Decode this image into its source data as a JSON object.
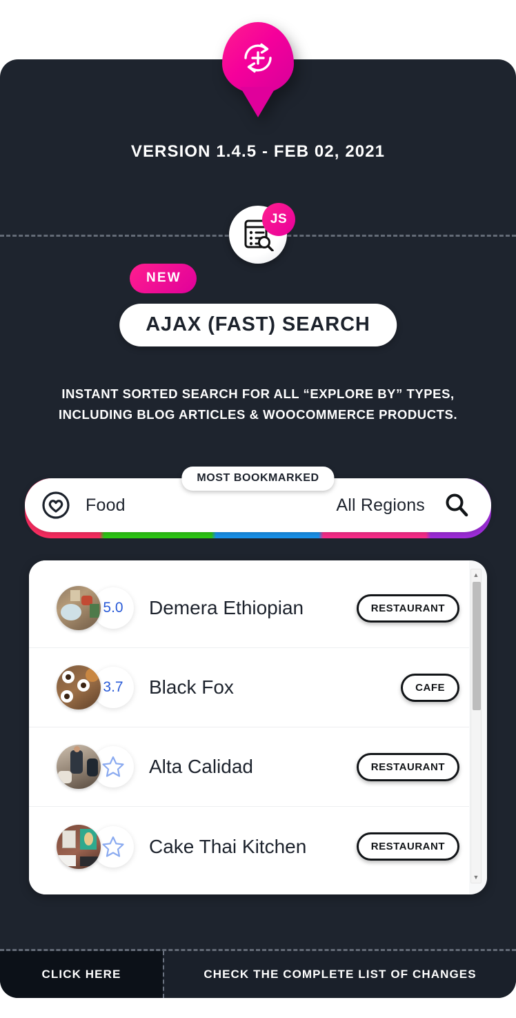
{
  "header": {
    "pin_icon": "refresh-plus-icon",
    "version_text": "VERSION 1.4.5 - FEB 02, 2021"
  },
  "feature": {
    "badge_icon": "document-search-icon",
    "tech_tag": "JS",
    "new_label": "NEW",
    "title": "AJAX (FAST) SEARCH",
    "description_line1": "INSTANT SORTED SEARCH FOR ALL “EXPLORE BY” TYPES,",
    "description_line2": "INCLUDING BLOG ARTICLES & WOOCOMMERCE PRODUCTS."
  },
  "search": {
    "tab_label": "MOST BOOKMARKED",
    "category_icon": "heart-circle-icon",
    "category_value": "Food",
    "region_value": "All Regions",
    "search_icon": "search-icon",
    "accent_bar_colors": [
      "#ff2e63",
      "#2ecc15",
      "#1a95f0",
      "#ff2e8e",
      "#a32ee0"
    ]
  },
  "results": {
    "rows": [
      {
        "rating": "5.0",
        "has_rating": true,
        "name": "Demera Ethiopian",
        "tag": "RESTAURANT",
        "thumb": "dining-table-photo"
      },
      {
        "rating": "3.7",
        "has_rating": true,
        "name": "Black Fox",
        "tag": "CAFE",
        "thumb": "coffee-table-photo"
      },
      {
        "rating": "",
        "has_rating": false,
        "name": "Alta Calidad",
        "tag": "RESTAURANT",
        "thumb": "people-shop-photo"
      },
      {
        "rating": "",
        "has_rating": false,
        "name": "Cake Thai Kitchen",
        "tag": "RESTAURANT",
        "thumb": "restaurant-art-photo"
      }
    ],
    "empty_rating_icon": "star-outline-icon",
    "rating_color": "#2a5bd7",
    "scrollbar": {
      "up_icon": "caret-up-icon",
      "down_icon": "caret-down-icon"
    }
  },
  "footer": {
    "left_label": "CLICK HERE",
    "right_label": "CHECK THE COMPLETE LIST OF CHANGES"
  },
  "colors": {
    "card_bg": "#1e242e",
    "accent_pink": "#f5009b",
    "footer_left_bg": "#0c1118"
  }
}
